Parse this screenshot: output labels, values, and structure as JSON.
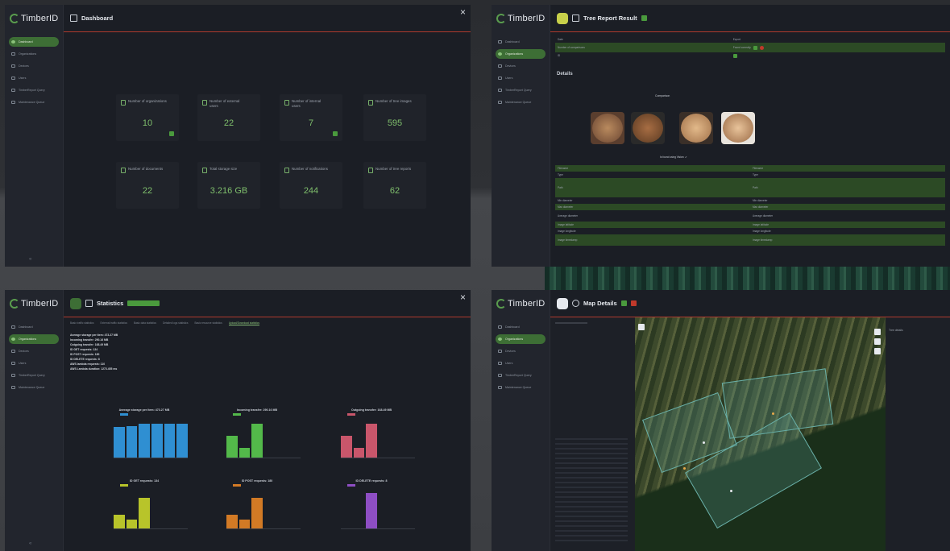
{
  "app": {
    "logo_text": "TimberID"
  },
  "sidebar": {
    "items": [
      {
        "label": "Dashboard",
        "icon": "dashboard-icon"
      },
      {
        "label": "Organizations",
        "icon": "organizations-icon"
      },
      {
        "label": "Devices",
        "icon": "devices-icon"
      },
      {
        "label": "Users",
        "icon": "users-icon"
      },
      {
        "label": "TimberReport Query",
        "icon": "query-icon"
      },
      {
        "label": "Maintenance Queue",
        "icon": "queue-icon"
      }
    ],
    "collapse_glyph": "«"
  },
  "dashboard": {
    "title": "Dashboard",
    "close_glyph": "×",
    "cards": [
      {
        "label": "Number of organizations",
        "value": "10",
        "has_button": true
      },
      {
        "label": "Number of external users",
        "value": "22",
        "has_button": false
      },
      {
        "label": "Number of internal users",
        "value": "7",
        "has_button": true
      },
      {
        "label": "Number of tree images",
        "value": "595",
        "has_button": false
      },
      {
        "label": "Number of documents",
        "value": "22",
        "has_button": false
      },
      {
        "label": "Total storage size",
        "value": "3.216 GB",
        "has_button": false
      },
      {
        "label": "Number of notifications",
        "value": "244",
        "has_button": false
      },
      {
        "label": "Number of tree reports",
        "value": "62",
        "has_button": false
      }
    ]
  },
  "tree_report": {
    "title": "Tree Report Result",
    "details_label": "Details",
    "comparison_label": "Comparison",
    "found_text": "Is found using Vision: ✔",
    "rows": [
      {
        "k1": "Date",
        "k2": "Export"
      },
      {
        "k1": "Number of comparisons",
        "k2": "Found correctly"
      },
      {
        "k1": "ID",
        "k2": ""
      }
    ],
    "detail_rows": [
      {
        "k1": "Filename",
        "k2": "Filename"
      },
      {
        "k1": "Type",
        "k2": "Type"
      },
      {
        "k1": "Path",
        "k2": "Path"
      },
      {
        "k1": "Min diameter",
        "k2": "Min diameter"
      },
      {
        "k1": "Max diameter",
        "k2": "Max diameter"
      },
      {
        "k1": "Average diameter",
        "k2": "Average diameter"
      },
      {
        "k1": "Image latitude",
        "k2": "Image latitude"
      },
      {
        "k1": "Image longitude",
        "k2": "Image longitude"
      },
      {
        "k1": "Image timestamp",
        "k2": "Image timestamp"
      }
    ]
  },
  "statistics": {
    "title": "Statistics",
    "tabs": [
      "Basic traffic statistics",
      "External traffic statistics",
      "Basic data statistics",
      "Detailed logs statistics",
      "Basic resource statistics",
      "Upload/Download statistics"
    ],
    "active_tab": 5,
    "summary": [
      "Average storage per item: 473.27 MB",
      "Incoming transfer: 290.16 MB",
      "Outgoing transfer: 168.49 MB",
      "ID GET requests: 134",
      "ID POST requests: 180",
      "ID DELETE requests: 8",
      "AWS lambda requests: 110",
      "AWS Lambda duration: 1273.455 ms"
    ],
    "charts": [
      {
        "title": "Average storage per item: 473.27 MB",
        "color": "#2f8fd2",
        "values": [
          78,
          80,
          85,
          86,
          86,
          86
        ]
      },
      {
        "title": "Incoming transfer: 290.16 MB",
        "color": "#53b94a",
        "values": [
          55,
          25,
          85,
          0,
          0,
          0
        ]
      },
      {
        "title": "Outgoing transfer: 168.49 MB",
        "color": "#c9566b",
        "values": [
          55,
          25,
          85,
          0,
          0,
          0
        ]
      },
      {
        "title": "ID GET requests: 134",
        "color": "#b8c42a",
        "values": [
          35,
          22,
          78,
          0,
          0,
          0
        ]
      },
      {
        "title": "ID POST requests: 180",
        "color": "#d27a25",
        "values": [
          35,
          22,
          78,
          0,
          0,
          0
        ]
      },
      {
        "title": "ID DELETE requests: 8",
        "color": "#8e4ec4",
        "values": [
          0,
          0,
          90,
          0,
          0,
          0
        ]
      }
    ]
  },
  "map_details": {
    "title": "Map Details",
    "right_panel_title": "Tree details",
    "colors": {
      "field": "#6ab0a8"
    }
  }
}
